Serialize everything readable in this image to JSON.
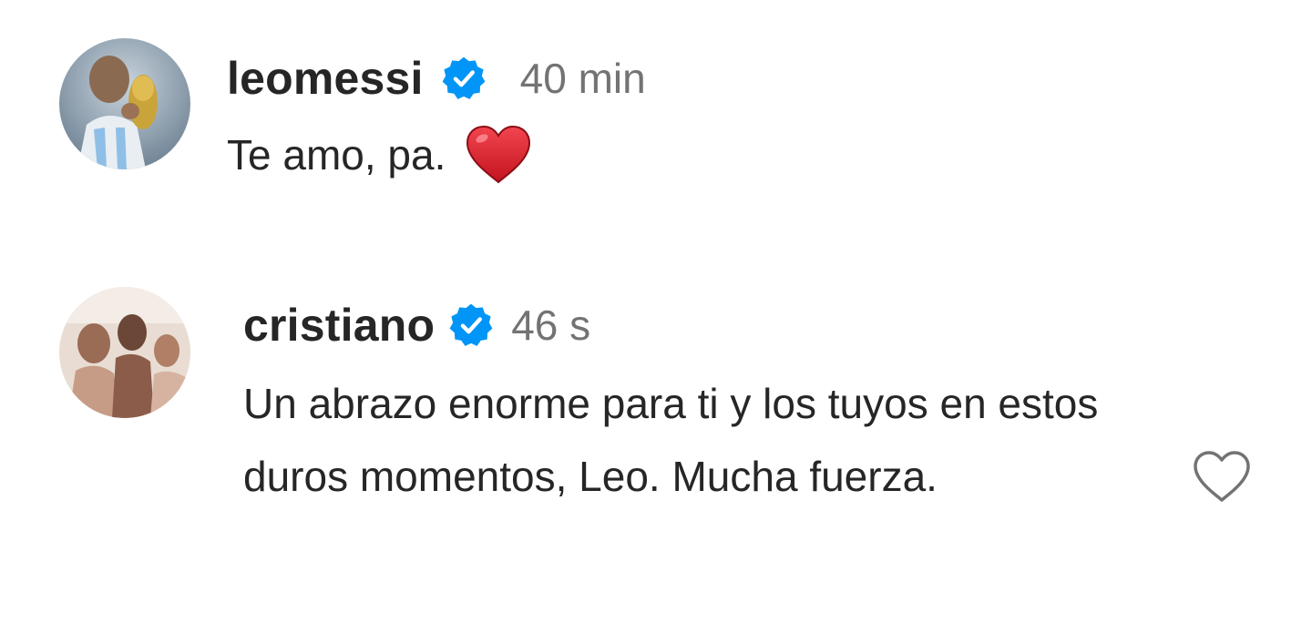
{
  "comments": [
    {
      "username": "leomessi",
      "verified": true,
      "time": "40 min",
      "text": "Te amo, pa.",
      "emoji": "red-heart-emoji"
    },
    {
      "username": "cristiano",
      "verified": true,
      "time": "46 s",
      "text": "Un abrazo enorme para ti y los tuyos en estos duros momentos, Leo. Mucha fuerza.",
      "like_icon": "heart-outline-icon"
    }
  ],
  "colors": {
    "text": "#262626",
    "muted": "#737373",
    "verified_blue": "#0095f6",
    "emoji_red": "#e3202f",
    "background": "#ffffff"
  }
}
